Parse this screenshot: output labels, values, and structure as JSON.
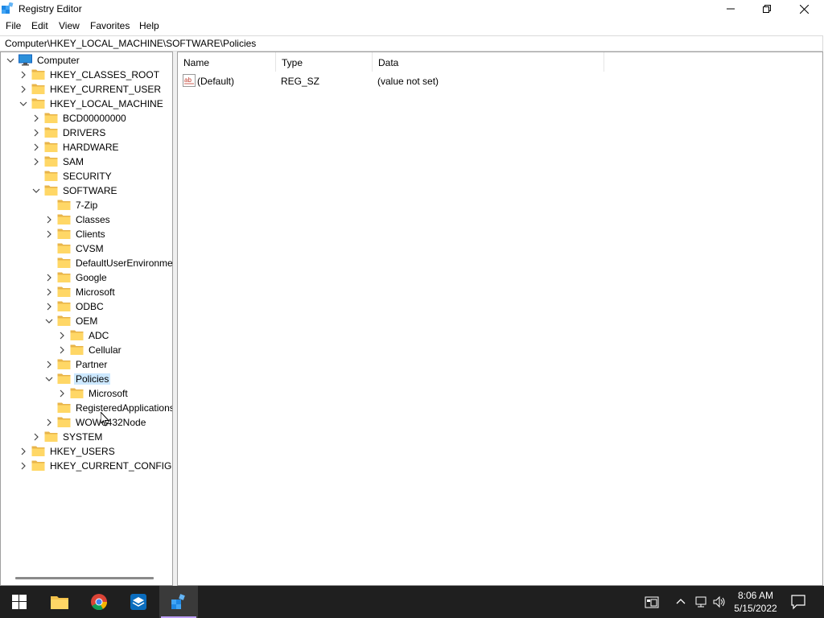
{
  "window": {
    "title": "Registry Editor"
  },
  "menu": [
    "File",
    "Edit",
    "View",
    "Favorites",
    "Help"
  ],
  "address": "Computer\\HKEY_LOCAL_MACHINE\\SOFTWARE\\Policies",
  "tree": [
    {
      "label": "Computer",
      "level": 0,
      "state": "expanded",
      "icon": "computer-icon"
    },
    {
      "label": "HKEY_CLASSES_ROOT",
      "level": 1,
      "state": "collapsed"
    },
    {
      "label": "HKEY_CURRENT_USER",
      "level": 1,
      "state": "collapsed"
    },
    {
      "label": "HKEY_LOCAL_MACHINE",
      "level": 1,
      "state": "expanded"
    },
    {
      "label": "BCD00000000",
      "level": 2,
      "state": "collapsed"
    },
    {
      "label": "DRIVERS",
      "level": 2,
      "state": "collapsed"
    },
    {
      "label": "HARDWARE",
      "level": 2,
      "state": "collapsed"
    },
    {
      "label": "SAM",
      "level": 2,
      "state": "collapsed"
    },
    {
      "label": "SECURITY",
      "level": 2,
      "state": "none"
    },
    {
      "label": "SOFTWARE",
      "level": 2,
      "state": "expanded"
    },
    {
      "label": "7-Zip",
      "level": 3,
      "state": "none"
    },
    {
      "label": "Classes",
      "level": 3,
      "state": "collapsed"
    },
    {
      "label": "Clients",
      "level": 3,
      "state": "collapsed"
    },
    {
      "label": "CVSM",
      "level": 3,
      "state": "none"
    },
    {
      "label": "DefaultUserEnvironmen",
      "level": 3,
      "state": "none"
    },
    {
      "label": "Google",
      "level": 3,
      "state": "collapsed"
    },
    {
      "label": "Microsoft",
      "level": 3,
      "state": "collapsed"
    },
    {
      "label": "ODBC",
      "level": 3,
      "state": "collapsed"
    },
    {
      "label": "OEM",
      "level": 3,
      "state": "expanded"
    },
    {
      "label": "ADC",
      "level": 4,
      "state": "collapsed"
    },
    {
      "label": "Cellular",
      "level": 4,
      "state": "collapsed"
    },
    {
      "label": "Partner",
      "level": 3,
      "state": "collapsed"
    },
    {
      "label": "Policies",
      "level": 3,
      "state": "expanded",
      "selected": true
    },
    {
      "label": "Microsoft",
      "level": 4,
      "state": "collapsed"
    },
    {
      "label": "RegisteredApplications",
      "level": 3,
      "state": "none"
    },
    {
      "label": "WOW6432Node",
      "level": 3,
      "state": "collapsed"
    },
    {
      "label": "SYSTEM",
      "level": 2,
      "state": "collapsed"
    },
    {
      "label": "HKEY_USERS",
      "level": 1,
      "state": "collapsed"
    },
    {
      "label": "HKEY_CURRENT_CONFIG",
      "level": 1,
      "state": "collapsed"
    }
  ],
  "values": {
    "columns": [
      "Name",
      "Type",
      "Data"
    ],
    "rows": [
      {
        "name": "(Default)",
        "type": "REG_SZ",
        "data": "(value not set)",
        "icon": "string-value-icon"
      }
    ]
  },
  "taskbar": {
    "apps": [
      "start-button",
      "file-explorer",
      "chrome",
      "sandbox-app",
      "registry-editor"
    ],
    "active": "registry-editor",
    "time": "8:06 AM",
    "date": "5/15/2022"
  },
  "colors": {
    "selection": "#cce8ff",
    "taskbar": "#1f1f1f",
    "folder": "#f3c14b",
    "accent": "#0078d4"
  }
}
